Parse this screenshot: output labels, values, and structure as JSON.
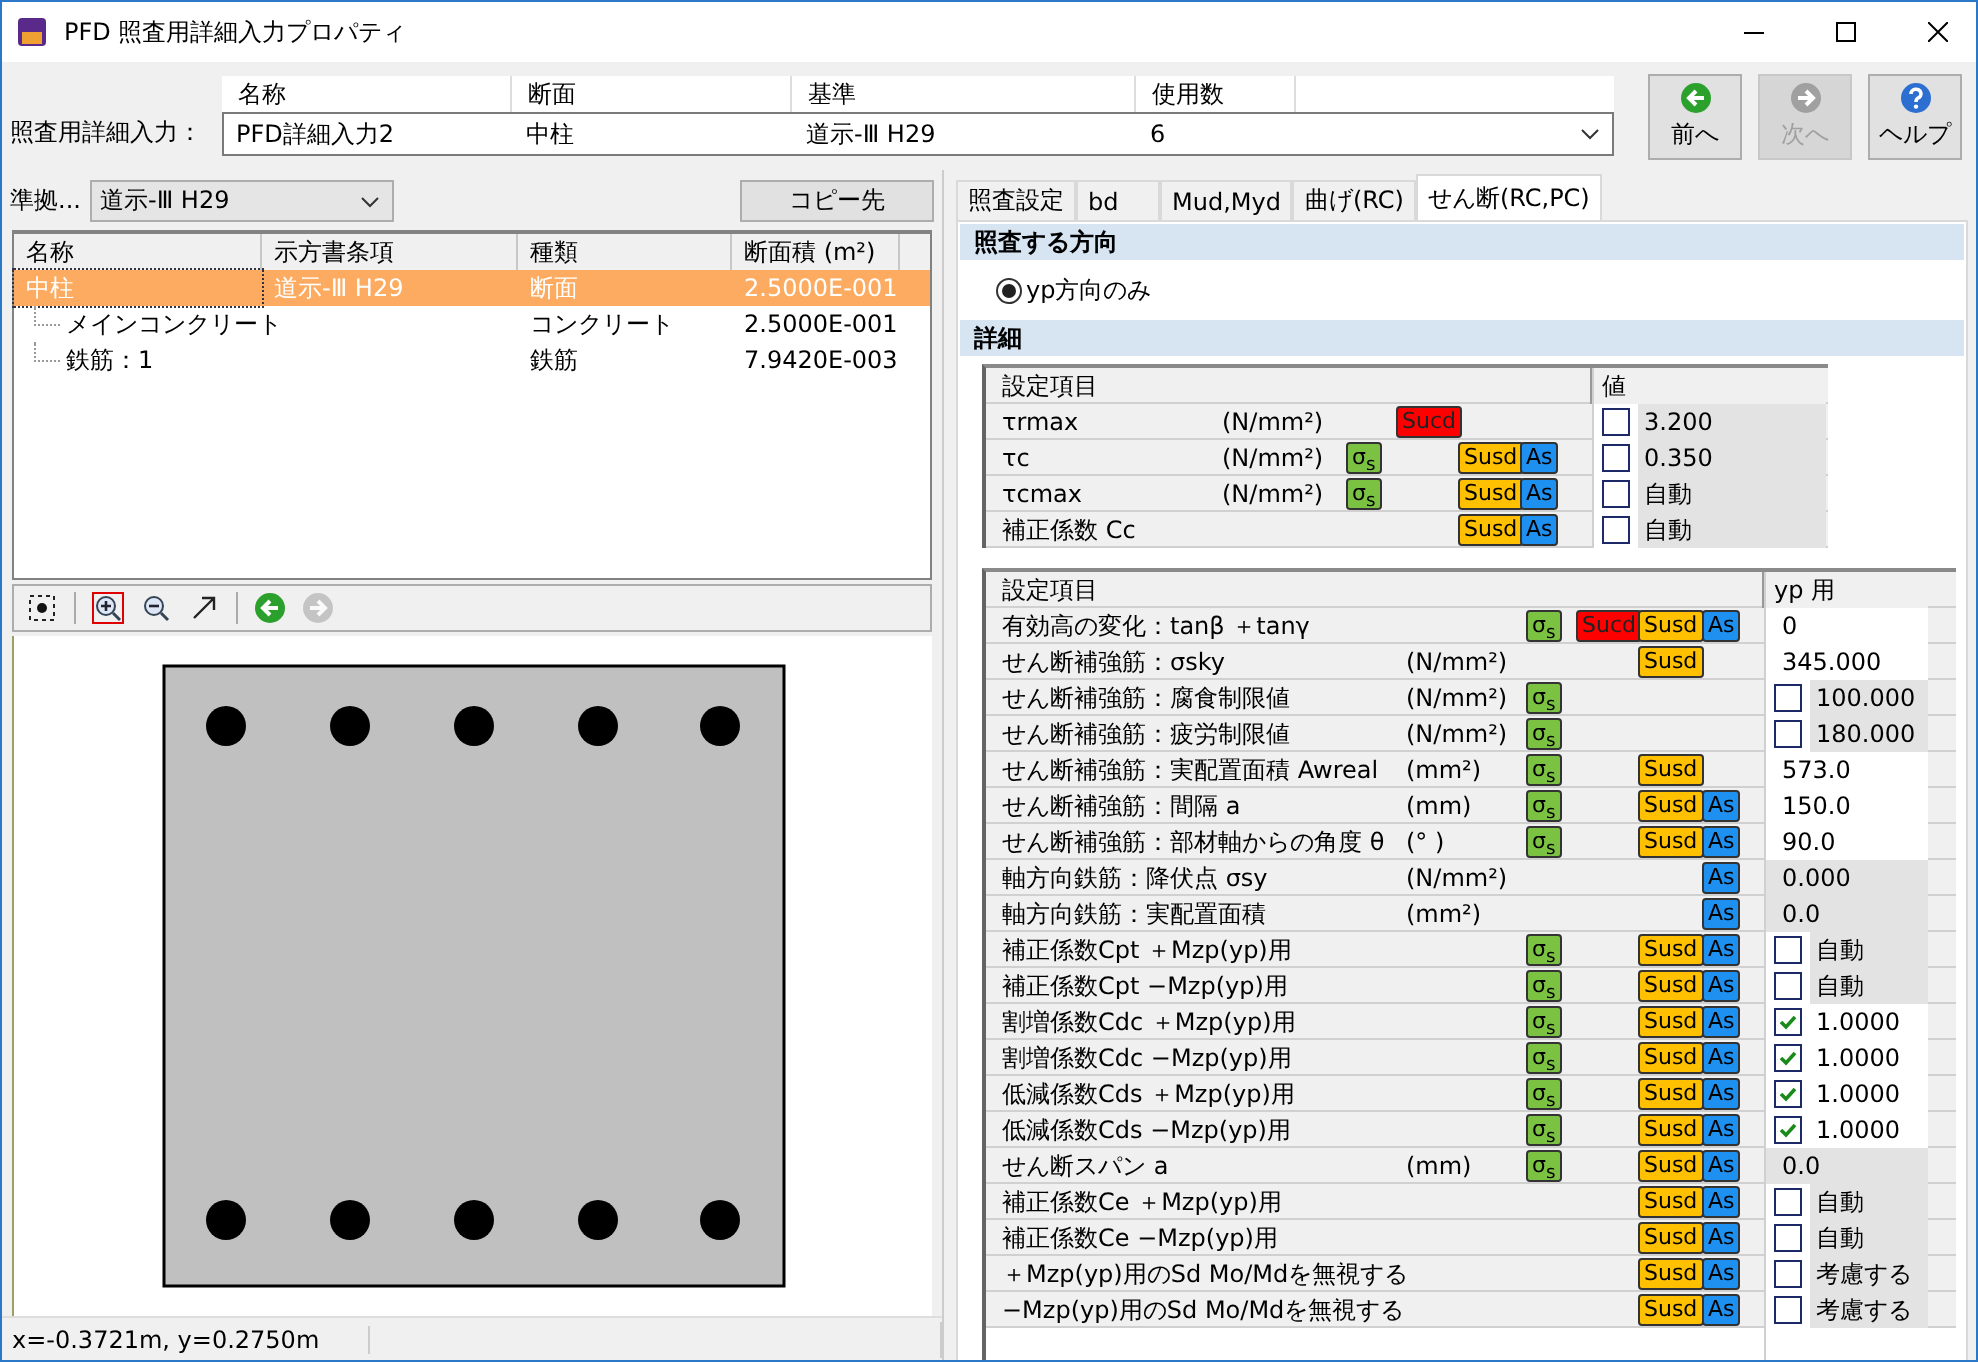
{
  "window": {
    "title": "PFD 照査用詳細入力プロパティ"
  },
  "header": {
    "label": "照査用詳細入力：",
    "columns": [
      "名称",
      "断面",
      "基準",
      "使用数"
    ],
    "values": [
      "PFD詳細入力2",
      "中柱",
      "道示-Ⅲ H29",
      "6"
    ]
  },
  "nav_buttons": [
    {
      "kind": "prev",
      "label": "前へ",
      "disabled": false
    },
    {
      "kind": "next",
      "label": "次へ",
      "disabled": true
    },
    {
      "kind": "help",
      "label": "ヘルプ",
      "disabled": false
    }
  ],
  "standard": {
    "label": "準拠...",
    "value": "道示-Ⅲ H29"
  },
  "copy_button": "コピー先",
  "tree": {
    "columns": [
      "名称",
      "示方書条項",
      "種類",
      "断面積 (m²)"
    ],
    "rows": [
      {
        "name": "中柱",
        "clause": "道示-Ⅲ H29",
        "type": "断面",
        "area": "2.5000E-001",
        "selected": true,
        "children": [
          {
            "name": "メインコンクリート",
            "type": "コンクリート",
            "area": "2.5000E-001",
            "selected": false
          },
          {
            "name": "鉄筋：1",
            "type": "鉄筋",
            "area": "7.9420E-003",
            "selected": false
          }
        ]
      }
    ]
  },
  "toolbar": [
    {
      "kind": "fit",
      "selected": false,
      "disabled": false
    },
    {
      "kind": "zoom_in",
      "selected": true,
      "disabled": false
    },
    {
      "kind": "zoom_out",
      "selected": false,
      "disabled": false
    },
    {
      "kind": "pan",
      "selected": false,
      "disabled": false
    },
    {
      "kind": "back",
      "selected": false,
      "disabled": false
    },
    {
      "kind": "forward",
      "selected": false,
      "disabled": true
    }
  ],
  "status_bar": {
    "coords": "x=-0.3721m, y=0.2750m"
  },
  "tabs": [
    {
      "label": "照査設定",
      "selected": false
    },
    {
      "label": "bd",
      "selected": false
    },
    {
      "label": "Mud,Myd",
      "selected": false
    },
    {
      "label": "曲げ(RC)",
      "selected": false
    },
    {
      "label": "せん断(RC,PC)",
      "selected": true
    }
  ],
  "direction": {
    "title": "照査する方向",
    "option": {
      "label": "yp方向のみ",
      "selected": true
    }
  },
  "detail": {
    "title": "詳細",
    "table1": {
      "columns": [
        "設定項目",
        "値"
      ],
      "rows": [
        {
          "label": "τrmax",
          "unit": "(N/mm²)",
          "badges": [
            {
              "kind": "sucd",
              "label": "Sucd"
            }
          ],
          "value": {
            "kind": "check",
            "checked": false,
            "text": "3.200"
          }
        },
        {
          "label": "τc",
          "unit": "(N/mm²)",
          "badges": [
            {
              "kind": "sigma",
              "label": "σ$_{s}$"
            },
            {
              "kind": "susd",
              "label": "Susd"
            },
            {
              "kind": "as",
              "label": "As"
            }
          ],
          "value": {
            "kind": "check",
            "checked": false,
            "text": "0.350"
          }
        },
        {
          "label": "τcmax",
          "unit": "(N/mm²)",
          "badges": [
            {
              "kind": "sigma",
              "label": "σ$_{s}$"
            },
            {
              "kind": "susd",
              "label": "Susd"
            },
            {
              "kind": "as",
              "label": "As"
            }
          ],
          "value": {
            "kind": "check",
            "checked": false,
            "text": "自動"
          }
        },
        {
          "label": "補正係数 Cc",
          "badges": [
            {
              "kind": "susd",
              "label": "Susd"
            },
            {
              "kind": "as",
              "label": "As"
            }
          ],
          "value": {
            "kind": "check",
            "checked": false,
            "text": "自動"
          }
        }
      ]
    },
    "table2": {
      "columns": [
        "設定項目",
        "yp 用"
      ],
      "rows": [
        {
          "label": "有効高の変化：tanβ ＋tanγ",
          "badges": [
            {
              "kind": "sigma",
              "label": "σ$_{s}$"
            },
            {
              "kind": "sucd",
              "label": "Sucd"
            },
            {
              "kind": "susd",
              "label": "Susd"
            },
            {
              "kind": "as",
              "label": "As"
            }
          ],
          "value": {
            "kind": "text",
            "editable": true,
            "text": "0"
          }
        },
        {
          "label": "せん断補強筋：σsky",
          "unit": "(N/mm²)",
          "badges": [
            {
              "kind": "susd",
              "label": "Susd"
            }
          ],
          "value": {
            "kind": "text",
            "editable": true,
            "text": "345.000"
          }
        },
        {
          "label": "せん断補強筋：腐食制限値",
          "unit": "(N/mm²)",
          "badges": [
            {
              "kind": "sigma",
              "label": "σ$_{s}$"
            }
          ],
          "value": {
            "kind": "check",
            "checked": false,
            "text": "100.000"
          }
        },
        {
          "label": "せん断補強筋：疲労制限値",
          "unit": "(N/mm²)",
          "badges": [
            {
              "kind": "sigma",
              "label": "σ$_{s}$"
            }
          ],
          "value": {
            "kind": "check",
            "checked": false,
            "text": "180.000"
          }
        },
        {
          "label": "せん断補強筋：実配置面積 Awreal",
          "unit": "(mm²)",
          "badges": [
            {
              "kind": "sigma",
              "label": "σ$_{s}$"
            },
            {
              "kind": "susd",
              "label": "Susd"
            }
          ],
          "value": {
            "kind": "text",
            "editable": true,
            "text": "573.0"
          }
        },
        {
          "label": "せん断補強筋：間隔 a",
          "unit": "(mm)",
          "badges": [
            {
              "kind": "sigma",
              "label": "σ$_{s}$"
            },
            {
              "kind": "susd",
              "label": "Susd"
            },
            {
              "kind": "as",
              "label": "As"
            }
          ],
          "value": {
            "kind": "text",
            "editable": true,
            "text": "150.0"
          }
        },
        {
          "label": "せん断補強筋：部材軸からの角度 θ",
          "unit": "(° )",
          "badges": [
            {
              "kind": "sigma",
              "label": "σ$_{s}$"
            },
            {
              "kind": "susd",
              "label": "Susd"
            },
            {
              "kind": "as",
              "label": "As"
            }
          ],
          "value": {
            "kind": "text",
            "editable": true,
            "text": "90.0"
          }
        },
        {
          "label": "軸方向鉄筋：降伏点 σsy",
          "unit": "(N/mm²)",
          "badges": [
            {
              "kind": "as",
              "label": "As"
            }
          ],
          "value": {
            "kind": "text",
            "editable": false,
            "text": "0.000"
          }
        },
        {
          "label": "軸方向鉄筋：実配置面積",
          "unit": "(mm²)",
          "badges": [
            {
              "kind": "as",
              "label": "As"
            }
          ],
          "value": {
            "kind": "text",
            "editable": false,
            "text": "0.0"
          }
        },
        {
          "label": "補正係数Cpt ＋Mzp(yp)用",
          "badges": [
            {
              "kind": "sigma",
              "label": "σ$_{s}$"
            },
            {
              "kind": "susd",
              "label": "Susd"
            },
            {
              "kind": "as",
              "label": "As"
            }
          ],
          "value": {
            "kind": "check",
            "checked": false,
            "text": "自動"
          }
        },
        {
          "label": "補正係数Cpt −Mzp(yp)用",
          "badges": [
            {
              "kind": "sigma",
              "label": "σ$_{s}$"
            },
            {
              "kind": "susd",
              "label": "Susd"
            },
            {
              "kind": "as",
              "label": "As"
            }
          ],
          "value": {
            "kind": "check",
            "checked": false,
            "text": "自動"
          }
        },
        {
          "label": "割増係数Cdc ＋Mzp(yp)用",
          "badges": [
            {
              "kind": "sigma",
              "label": "σ$_{s}$"
            },
            {
              "kind": "susd",
              "label": "Susd"
            },
            {
              "kind": "as",
              "label": "As"
            }
          ],
          "value": {
            "kind": "check",
            "checked": true,
            "text": "1.0000"
          }
        },
        {
          "label": "割増係数Cdc −Mzp(yp)用",
          "badges": [
            {
              "kind": "sigma",
              "label": "σ$_{s}$"
            },
            {
              "kind": "susd",
              "label": "Susd"
            },
            {
              "kind": "as",
              "label": "As"
            }
          ],
          "value": {
            "kind": "check",
            "checked": true,
            "text": "1.0000"
          }
        },
        {
          "label": "低減係数Cds ＋Mzp(yp)用",
          "badges": [
            {
              "kind": "sigma",
              "label": "σ$_{s}$"
            },
            {
              "kind": "susd",
              "label": "Susd"
            },
            {
              "kind": "as",
              "label": "As"
            }
          ],
          "value": {
            "kind": "check",
            "checked": true,
            "text": "1.0000"
          }
        },
        {
          "label": "低減係数Cds −Mzp(yp)用",
          "badges": [
            {
              "kind": "sigma",
              "label": "σ$_{s}$"
            },
            {
              "kind": "susd",
              "label": "Susd"
            },
            {
              "kind": "as",
              "label": "As"
            }
          ],
          "value": {
            "kind": "check",
            "checked": true,
            "text": "1.0000"
          }
        },
        {
          "label": "せん断スパン a",
          "unit": "(mm)",
          "badges": [
            {
              "kind": "sigma",
              "label": "σ$_{s}$"
            },
            {
              "kind": "susd",
              "label": "Susd"
            },
            {
              "kind": "as",
              "label": "As"
            }
          ],
          "value": {
            "kind": "text",
            "editable": false,
            "text": "0.0"
          }
        },
        {
          "label": "補正係数Ce ＋Mzp(yp)用",
          "badges": [
            {
              "kind": "susd",
              "label": "Susd"
            },
            {
              "kind": "as",
              "label": "As"
            }
          ],
          "value": {
            "kind": "check",
            "checked": false,
            "text": "自動"
          }
        },
        {
          "label": "補正係数Ce −Mzp(yp)用",
          "badges": [
            {
              "kind": "susd",
              "label": "Susd"
            },
            {
              "kind": "as",
              "label": "As"
            }
          ],
          "value": {
            "kind": "check",
            "checked": false,
            "text": "自動"
          }
        },
        {
          "label": "＋Mzp(yp)用のSd Mo/Mdを無視する",
          "badges": [
            {
              "kind": "susd",
              "label": "Susd"
            },
            {
              "kind": "as",
              "label": "As"
            }
          ],
          "value": {
            "kind": "check",
            "checked": false,
            "text": "考慮する"
          }
        },
        {
          "label": "−Mzp(yp)用のSd Mo/Mdを無視する",
          "badges": [
            {
              "kind": "susd",
              "label": "Susd"
            },
            {
              "kind": "as",
              "label": "As"
            }
          ],
          "value": {
            "kind": "check",
            "checked": false,
            "text": "考慮する"
          }
        }
      ]
    }
  }
}
